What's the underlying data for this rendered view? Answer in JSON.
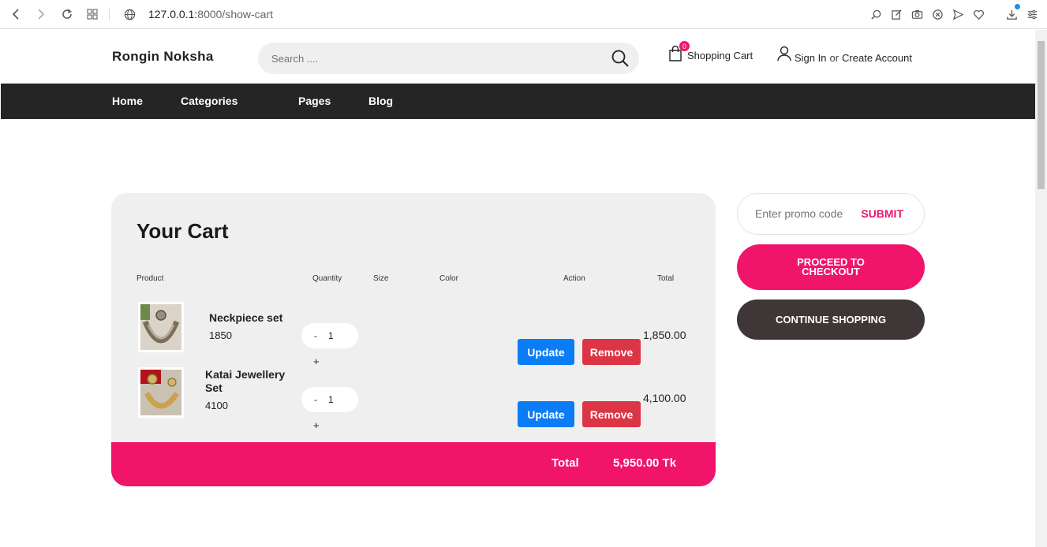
{
  "browser": {
    "url_host": "127.0.0.1:",
    "url_path": "8000/show-cart"
  },
  "header": {
    "brand": "Rongin Noksha",
    "search_placeholder": "Search ....",
    "cart_count": "0",
    "cart_label": "Shopping Cart",
    "sign_in": "Sign In",
    "or": "or",
    "create_account": "Create Account"
  },
  "nav": {
    "items": [
      "Home",
      "Categories",
      "Pages",
      "Blog"
    ]
  },
  "cart": {
    "title": "Your Cart",
    "columns": {
      "product": "Product",
      "quantity": "Quantity",
      "size": "Size",
      "color": "Color",
      "action": "Action",
      "total": "Total"
    },
    "rows": [
      {
        "name": "Neckpiece set",
        "price": "1850",
        "qty": "1",
        "total": "1,850.00"
      },
      {
        "name": "Katai Jewellery Set",
        "price": "4100",
        "qty": "1",
        "total": "4,100.00"
      }
    ],
    "minus": "-",
    "plus": "+",
    "update_label": "Update",
    "remove_label": "Remove",
    "total_label": "Total",
    "total_value": "5,950.00 Tk"
  },
  "side": {
    "promo_placeholder": "Enter promo code",
    "submit": "SUBMIT",
    "checkout": "PROCEED TO CHECKOUT",
    "continue": "CONTINUE SHOPPING"
  },
  "colors": {
    "accent": "#f0146b",
    "nav_bg": "#252525",
    "update": "#0a7cf5",
    "remove": "#dc3545",
    "continue": "#3f3737"
  }
}
